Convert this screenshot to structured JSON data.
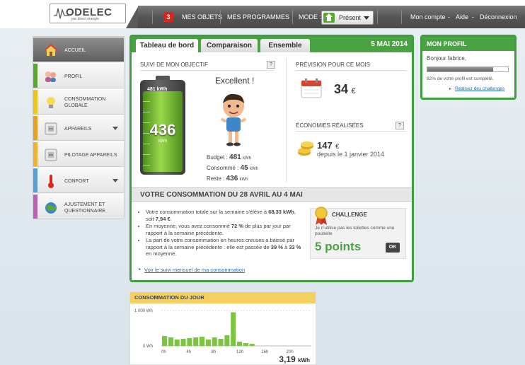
{
  "logo": {
    "brand": "ODELEC",
    "tagline": "par direct énergie"
  },
  "nav": {
    "badge": "3",
    "objets": "MES OBJETS",
    "programmes": "MES PROGRAMMES",
    "mode_label": "MODE :",
    "mode_value": "Présent",
    "account": "Mon compte",
    "dash1": "-",
    "help": "Aide",
    "dash2": "-",
    "logout": "Déconnexion"
  },
  "sidebar": {
    "items": [
      {
        "label": "ACCUEIL",
        "color": "#7a7a7a",
        "icon": "house-icon"
      },
      {
        "label": "PROFIL",
        "color": "#5aa832",
        "icon": "people-icon"
      },
      {
        "label": "CONSOMMATION GLOBALE",
        "color": "#f0c419",
        "icon": "bulb-icon"
      },
      {
        "label": "APPAREILS",
        "color": "#e8a020",
        "icon": "socket-icon"
      },
      {
        "label": "PILOTAGE APPAREILS",
        "color": "#f0b030",
        "icon": "socket-icon"
      },
      {
        "label": "CONFORT",
        "color": "#5aa0d8",
        "icon": "thermometer-icon"
      },
      {
        "label": "AJUSTEMENT ET QUESTIONNAIRE",
        "color": "#c060b0",
        "icon": "globe-icon"
      }
    ]
  },
  "main": {
    "tabs": [
      "Tableau de bord",
      "Comparaison",
      "Ensemble"
    ],
    "date": "5 MAI 2014",
    "objective": {
      "title": "SUIVI DE MON OBJECTIF",
      "help": "?",
      "battery_label": "481 kWh",
      "battery_value": "436",
      "battery_unit": "kWh",
      "battery_level": 0.906,
      "status": "Excellent !",
      "budget_label": "Budget :",
      "budget_value": "481",
      "budget_unit": "kWh",
      "consumed_label": "Consommé :",
      "consumed_value": "45",
      "consumed_unit": "kWh",
      "remaining_label": "Reste :",
      "remaining_value": "436",
      "remaining_unit": "kWh"
    },
    "forecast": {
      "title": "PRÉVISION POUR CE MOIS",
      "value": "34",
      "currency": "€"
    },
    "savings": {
      "title": "ÉCONOMIES RÉALISÉES",
      "help": "?",
      "value": "147",
      "currency": "€",
      "since": "depuis le 1 janvier 2014"
    },
    "weekly": {
      "title": "VOTRE CONSOMMATION DU 28 AVRIL AU 4 MAI",
      "b1_a": "Votre consommation totale sur la semaine s'élève à ",
      "b1_b": "68,33 kWh",
      "b1_c": ", soit ",
      "b1_d": "7,94 €",
      "b1_e": ".",
      "b2_a": "En moyenne, vous avez consommé ",
      "b2_b": "72 %",
      "b2_c": " de plus par jour par rapport à la semaine précédente.",
      "b3_a": "La part de votre consommation en heures creuses a baissé par rapport à la semaine précédente : elle est passée de ",
      "b3_b": "39 %",
      "b3_c": " à ",
      "b3_d": "33 %",
      "b3_e": " en moyenne.",
      "link": "Voir le suivi mensuel de ma consommation"
    },
    "challenge": {
      "title": "CHALLENGE",
      "text": "Je n'utilise pas les toilettes comme une poubelle",
      "points": "5 points",
      "ok": "OK"
    }
  },
  "profile": {
    "title": "MON PROFIL",
    "greeting": "Bonjour fabrice,",
    "completion": 0.82,
    "completion_text": "82% de votre profil est complété.",
    "link": "Réalisez des challenges"
  },
  "day": {
    "title": "CONSOMMATION DU JOUR",
    "y_top": "1 000 Wh",
    "y_bottom": "0 Wh",
    "x_labels": [
      "0h",
      "4h",
      "8h",
      "12h",
      "16h",
      "20h"
    ],
    "total": "3,19",
    "total_unit": "kWh",
    "chart_data": {
      "type": "bar",
      "ylim": [
        0,
        1000
      ],
      "values": [
        280,
        240,
        180,
        200,
        220,
        240,
        260,
        180,
        240,
        200,
        300,
        950,
        120,
        80,
        60,
        0,
        0,
        0,
        0,
        0,
        0,
        0,
        0,
        0
      ]
    }
  }
}
